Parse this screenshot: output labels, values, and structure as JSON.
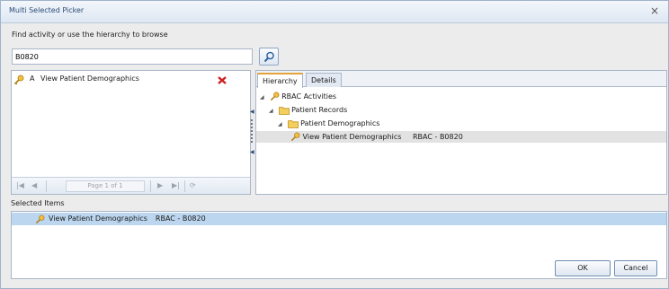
{
  "window": {
    "title": "Multi Selected Picker",
    "close_label": "×"
  },
  "instructions": "Find activity or use the hierarchy to browse",
  "search": {
    "value": "B0820"
  },
  "left_list": {
    "items": [
      {
        "letter": "A",
        "label": "View Patient Demographics"
      }
    ]
  },
  "pager": {
    "page_text": "Page 1 of 1"
  },
  "tabs": [
    {
      "label": "Hierarchy",
      "active": true
    },
    {
      "label": "Details",
      "active": false
    }
  ],
  "tree": [
    {
      "label": "RBAC Activities",
      "icon": "key-icon"
    },
    {
      "label": "Patient Records",
      "icon": "folder-icon"
    },
    {
      "label": "Patient Demographics",
      "icon": "folder-icon"
    },
    {
      "label": "View Patient Demographics",
      "code": "RBAC - B0820",
      "icon": "key-icon",
      "selected": true
    }
  ],
  "selected": {
    "header": "Selected Items",
    "items": [
      {
        "label": "View Patient Demographics",
        "code": "RBAC - B0820"
      }
    ]
  },
  "buttons": {
    "ok": "OK",
    "cancel": "Cancel"
  },
  "colors": {
    "selection": "#bcd6ef",
    "tab_accent": "#e5a23a",
    "remove": "#cc2222",
    "key": "#e0a020"
  }
}
